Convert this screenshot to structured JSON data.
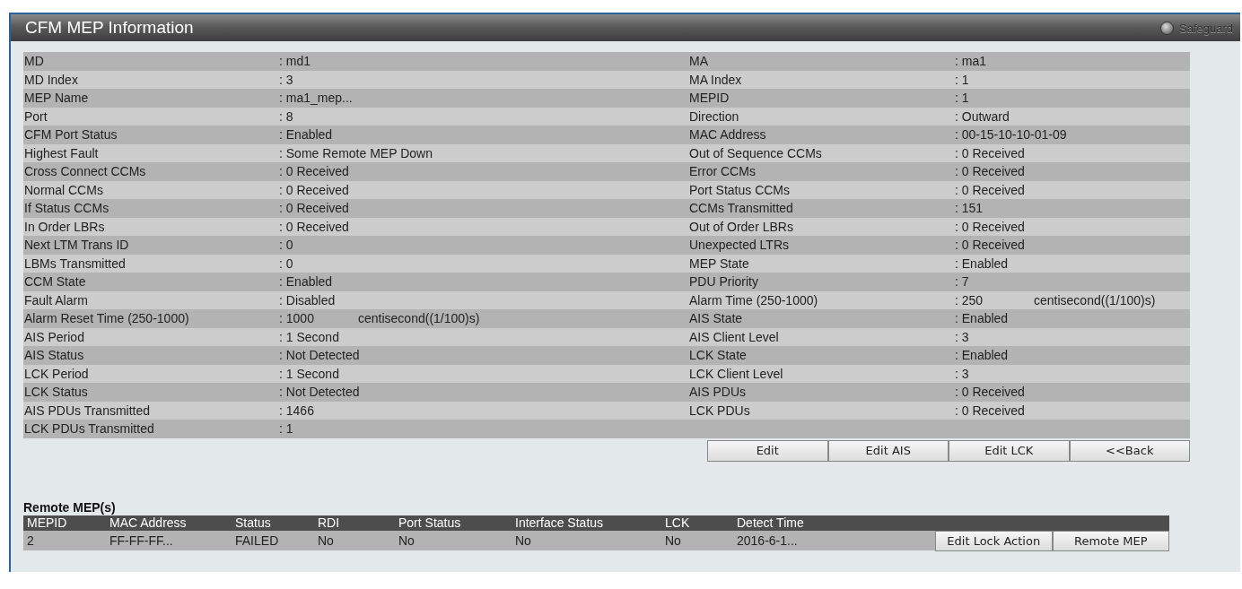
{
  "panel": {
    "title": "CFM MEP Information",
    "safeguard": "Safeguard"
  },
  "info": {
    "rows": [
      {
        "left": {
          "label": "MD",
          "value": ": md1"
        },
        "right": {
          "label": "MA",
          "value": ": ma1"
        }
      },
      {
        "left": {
          "label": "MD Index",
          "value": ": 3"
        },
        "right": {
          "label": "MA Index",
          "value": ": 1"
        }
      },
      {
        "left": {
          "label": "MEP Name",
          "value": ": ma1_mep..."
        },
        "right": {
          "label": "MEPID",
          "value": ": 1"
        }
      },
      {
        "left": {
          "label": "Port",
          "value": ": 8"
        },
        "right": {
          "label": "Direction",
          "value": ": Outward"
        }
      },
      {
        "left": {
          "label": "CFM Port Status",
          "value": ": Enabled"
        },
        "right": {
          "label": "MAC Address",
          "value": ": 00-15-10-10-01-09"
        }
      },
      {
        "left": {
          "label": "Highest Fault",
          "value": ": Some Remote MEP Down"
        },
        "right": {
          "label": "Out of Sequence CCMs",
          "value": ": 0 Received"
        }
      },
      {
        "left": {
          "label": "Cross Connect CCMs",
          "value": ": 0 Received"
        },
        "right": {
          "label": "Error CCMs",
          "value": ": 0 Received"
        }
      },
      {
        "left": {
          "label": "Normal CCMs",
          "value": ": 0 Received"
        },
        "right": {
          "label": "Port Status CCMs",
          "value": ": 0 Received"
        }
      },
      {
        "left": {
          "label": "If Status CCMs",
          "value": ": 0 Received"
        },
        "right": {
          "label": "CCMs Transmitted",
          "value": ": 151"
        }
      },
      {
        "left": {
          "label": "In Order LBRs",
          "value": ": 0 Received"
        },
        "right": {
          "label": "Out of Order LBRs",
          "value": ": 0 Received"
        }
      },
      {
        "left": {
          "label": "Next LTM Trans ID",
          "value": ": 0"
        },
        "right": {
          "label": "Unexpected LTRs",
          "value": ": 0 Received"
        }
      },
      {
        "left": {
          "label": "LBMs Transmitted",
          "value": ": 0"
        },
        "right": {
          "label": "MEP State",
          "value": ": Enabled"
        }
      },
      {
        "left": {
          "label": "CCM State",
          "value": ": Enabled"
        },
        "right": {
          "label": "PDU Priority",
          "value": ": 7"
        }
      },
      {
        "left": {
          "label": "Fault Alarm",
          "value": ": Disabled"
        },
        "right": {
          "label": "Alarm Time (250-1000)",
          "value": ": 250",
          "unit": "centisecond((1/100)s)"
        }
      },
      {
        "left": {
          "label": "Alarm Reset Time (250-1000)",
          "value": ": 1000",
          "unit": "centisecond((1/100)s)"
        },
        "right": {
          "label": "AIS State",
          "value": ": Enabled"
        }
      },
      {
        "left": {
          "label": "AIS Period",
          "value": ": 1 Second"
        },
        "right": {
          "label": "AIS Client Level",
          "value": ": 3"
        }
      },
      {
        "left": {
          "label": "AIS Status",
          "value": ": Not Detected"
        },
        "right": {
          "label": "LCK State",
          "value": ": Enabled"
        }
      },
      {
        "left": {
          "label": "LCK Period",
          "value": ": 1 Second"
        },
        "right": {
          "label": "LCK Client Level",
          "value": ": 3"
        }
      },
      {
        "left": {
          "label": "LCK Status",
          "value": ": Not Detected"
        },
        "right": {
          "label": "AIS PDUs",
          "value": ": 0 Received"
        }
      },
      {
        "left": {
          "label": "AIS PDUs Transmitted",
          "value": ": 1466"
        },
        "right": {
          "label": "LCK PDUs",
          "value": ": 0 Received"
        }
      },
      {
        "left": {
          "label": "LCK PDUs Transmitted",
          "value": ": 1"
        }
      }
    ]
  },
  "buttons": [
    "Edit",
    "Edit AIS",
    "Edit LCK",
    "<<Back"
  ],
  "remote": {
    "title": "Remote MEP(s)",
    "columns": [
      "MEPID",
      "MAC Address",
      "Status",
      "RDI",
      "Port Status",
      "Interface Status",
      "LCK",
      "Detect Time"
    ],
    "rows": [
      {
        "cells": [
          "2",
          "FF-FF-FF...",
          "FAILED",
          "No",
          "No",
          "No",
          "No",
          "2016-6-1..."
        ],
        "buttons": [
          "Edit Lock Action",
          "Remote MEP"
        ]
      }
    ]
  }
}
